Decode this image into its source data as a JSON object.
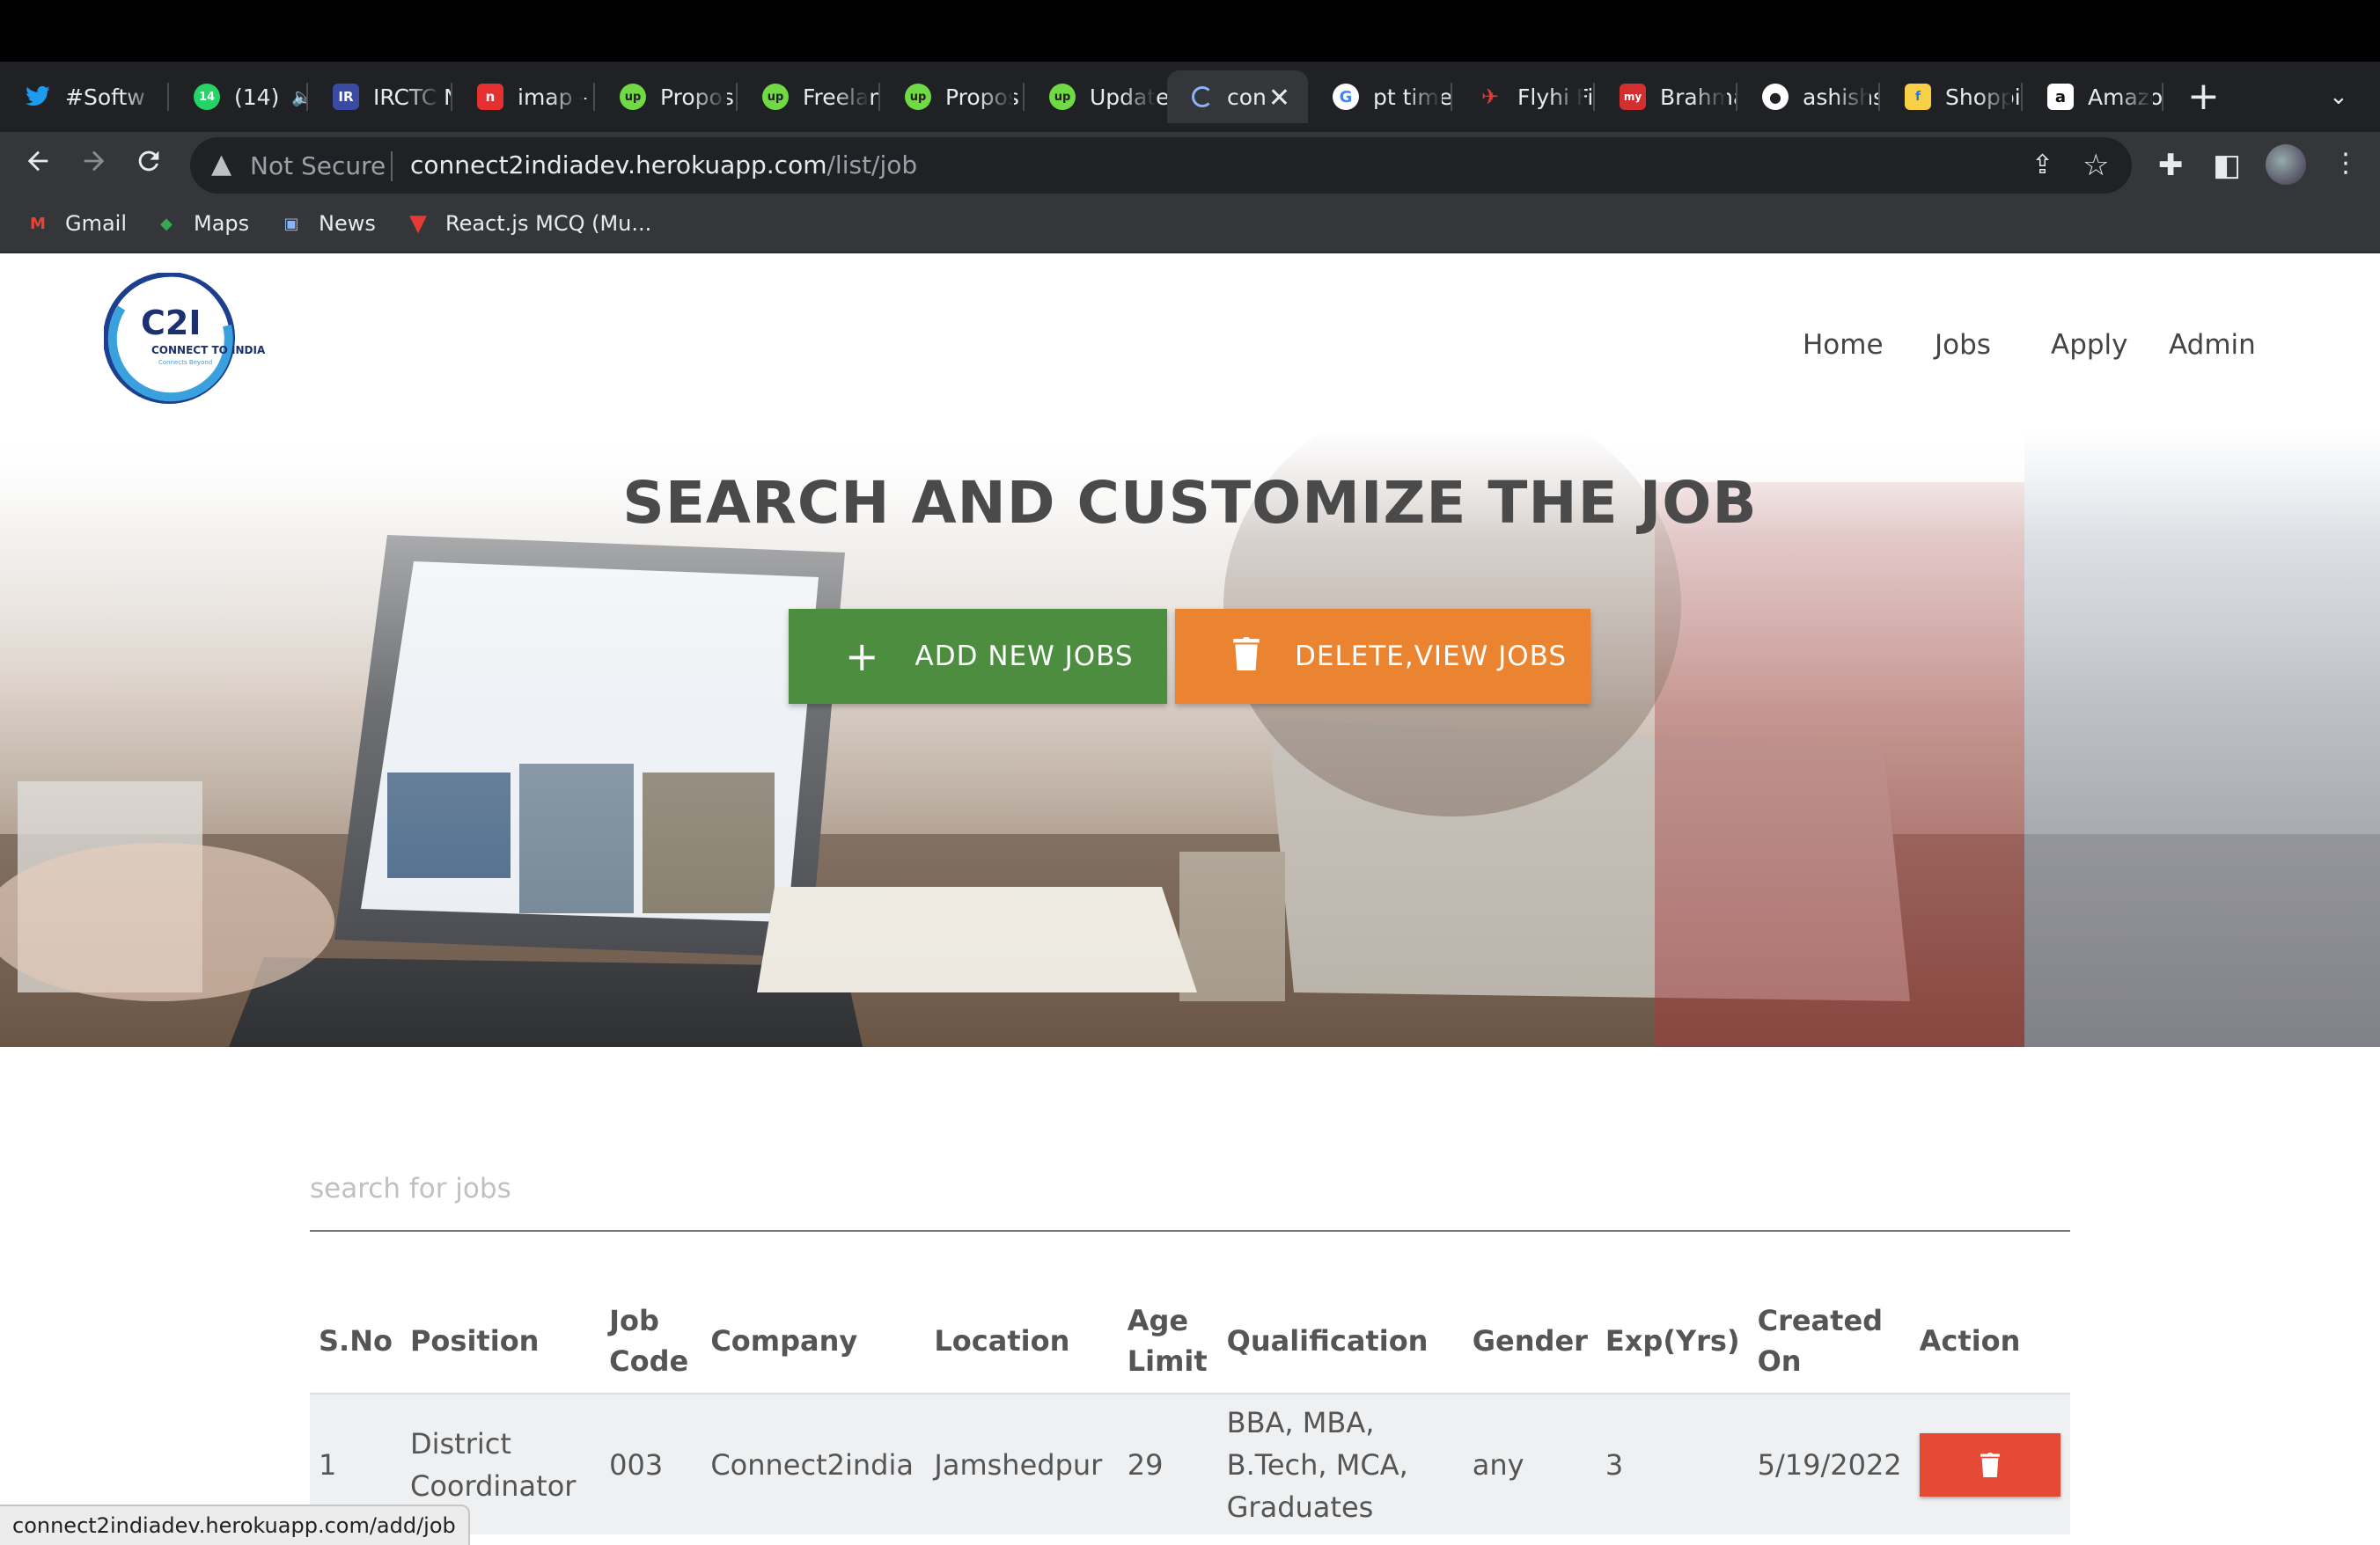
{
  "browser": {
    "tabs": [
      {
        "title": "#Softw",
        "icon": "twitter-icon",
        "color": "#1d9bf0"
      },
      {
        "title": "(14)",
        "icon": "whatsapp-icon",
        "color": "#25d366",
        "badge": "14"
      },
      {
        "title": "IRCTC N",
        "icon": "irctc-icon",
        "color": "#3b4aa3"
      },
      {
        "title": "imap - g",
        "icon": "imap-icon",
        "color": "#e63030"
      },
      {
        "title": "Propos",
        "icon": "upwork-icon",
        "color": "#6fda44"
      },
      {
        "title": "Freelan",
        "icon": "upwork-icon",
        "color": "#6fda44"
      },
      {
        "title": "Propos",
        "icon": "upwork-icon",
        "color": "#6fda44"
      },
      {
        "title": "Update",
        "icon": "upwork-icon",
        "color": "#6fda44"
      },
      {
        "title": "con",
        "icon": "loading-icon",
        "color": "#8ab4f8",
        "active": true
      },
      {
        "title": "pt time",
        "icon": "google-icon",
        "color": "#ffffff"
      },
      {
        "title": "Flyhi Fi",
        "icon": "flyhi-icon",
        "color": "#e53935"
      },
      {
        "title": "Brahma",
        "icon": "myntra-icon",
        "color": "#d32f2f"
      },
      {
        "title": "ashishs",
        "icon": "github-icon",
        "color": "#ffffff"
      },
      {
        "title": "Shoppi",
        "icon": "shopping-icon",
        "color": "#f7d046"
      },
      {
        "title": "Amazon",
        "icon": "amazon-icon",
        "color": "#ffffff"
      }
    ],
    "omnibox": {
      "security": "Not Secure",
      "url_host": "connect2indiadev.herokuapp.com",
      "url_path": "/list/job"
    },
    "bookmarks": [
      {
        "label": "Gmail",
        "icon": "gmail-icon"
      },
      {
        "label": "Maps",
        "icon": "maps-icon"
      },
      {
        "label": "News",
        "icon": "news-icon"
      },
      {
        "label": "React.js MCQ (Mu...",
        "icon": "react-mcq-icon"
      }
    ],
    "status_url": "connect2indiadev.herokuapp.com/add/job"
  },
  "site": {
    "logo": {
      "mark": "C2I",
      "text": "CONNECT TO INDIA",
      "tagline": "Connects Beyond"
    },
    "nav": [
      "Home",
      "Jobs",
      "Apply",
      "Admin"
    ],
    "hero_title": "SEARCH AND CUSTOMIZE THE JOB",
    "add_button": "ADD NEW JOBS",
    "delete_view_button": "DELETE,VIEW JOBS",
    "search_placeholder": "search for jobs",
    "colors": {
      "green": "#4c8d3f",
      "orange": "#ea8430",
      "red": "#e54a36"
    }
  },
  "table": {
    "headers": [
      "S.No",
      "Position",
      "Job Code",
      "Company",
      "Location",
      "Age Limit",
      "Qualification",
      "Gender",
      "Exp(Yrs)",
      "Created On",
      "Action"
    ],
    "rows": [
      {
        "sno": "1",
        "position": "District Coordinator",
        "job_code": "003",
        "company": "Connect2india",
        "location": "Jamshedpur",
        "age_limit": "29",
        "qualification": "BBA, MBA, B.Tech, MCA, Graduates",
        "gender": "any",
        "exp": "3",
        "created_on": "5/19/2022"
      }
    ]
  }
}
